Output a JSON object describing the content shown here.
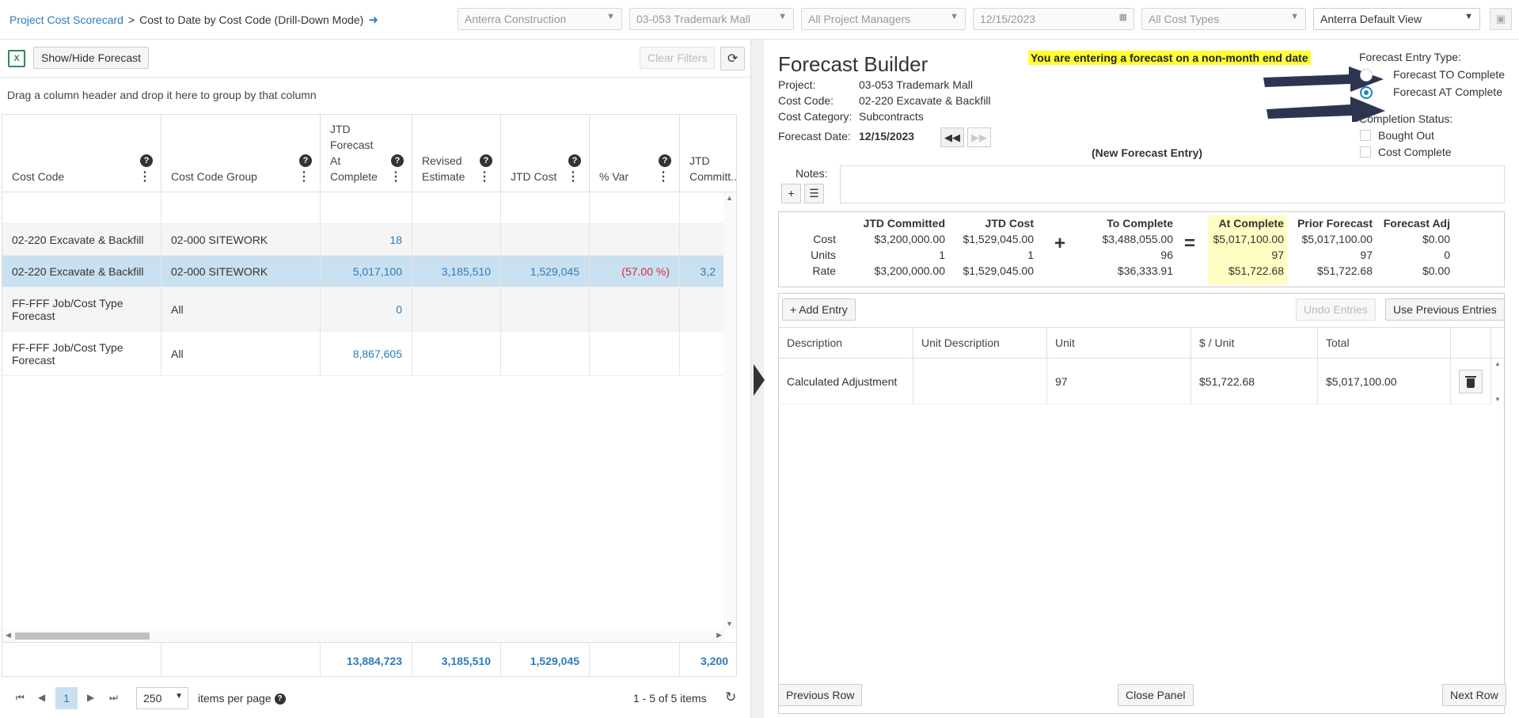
{
  "breadcrumb": {
    "parent": "Project Cost Scorecard",
    "separator": ">",
    "current": "Cost to Date by Cost Code  (Drill-Down Mode)",
    "exit_icon": "exit-arrow-icon"
  },
  "filters": {
    "company": "Anterra Construction",
    "project": "03-053 Trademark Mall",
    "manager": "All Project Managers",
    "date": "12/15/2023",
    "cost_types": "All Cost Types",
    "view": "Anterra Default View"
  },
  "grid_toolbar": {
    "excel_icon": "excel-icon",
    "excel_glyph": "X",
    "show_hide": "Show/Hide Forecast",
    "clear_filters": "Clear Filters",
    "refresh_glyph": "⟳"
  },
  "group_hint": "Drag a column header and drop it here to group by that column",
  "columns": [
    {
      "label": "Cost Code"
    },
    {
      "label": "Cost Code Group"
    },
    {
      "label": "JTD Forecast At Complete"
    },
    {
      "label": "Revised Estimate"
    },
    {
      "label": "JTD Cost"
    },
    {
      "label": "% Var"
    },
    {
      "label": "JTD Committ..."
    }
  ],
  "rows": [
    {
      "code": "",
      "group": "",
      "forecast": "",
      "revised": "",
      "jtd_cost": "",
      "var": "",
      "committed": ""
    },
    {
      "code": "02-220 Excavate & Backfill",
      "group": "02-000 SITEWORK",
      "forecast": "18",
      "revised": "",
      "jtd_cost": "",
      "var": "",
      "committed": ""
    },
    {
      "code": "02-220 Excavate & Backfill",
      "group": "02-000 SITEWORK",
      "forecast": "5,017,100",
      "revised": "3,185,510",
      "jtd_cost": "1,529,045",
      "var": "(57.00 %)",
      "committed": "3,2"
    },
    {
      "code": "FF-FFF Job/Cost Type Forecast",
      "group": "All",
      "forecast": "0",
      "revised": "",
      "jtd_cost": "",
      "var": "",
      "committed": ""
    },
    {
      "code": "FF-FFF Job/Cost Type Forecast",
      "group": "All",
      "forecast": "8,867,605",
      "revised": "",
      "jtd_cost": "",
      "var": "",
      "committed": ""
    }
  ],
  "totals": {
    "forecast": "13,884,723",
    "revised": "3,185,510",
    "jtd_cost": "1,529,045",
    "committed": "3,200"
  },
  "pager": {
    "page": "1",
    "page_size": "250",
    "items_per_page": "items per page",
    "count": "1 - 5 of 5 items"
  },
  "forecast_builder": {
    "title": "Forecast Builder",
    "warning": "You are entering a forecast on a non-month end date",
    "project_label": "Project:",
    "project": "03-053 Trademark Mall",
    "cost_code_label": "Cost Code:",
    "cost_code": "02-220 Excavate & Backfill",
    "cost_category_label": "Cost Category:",
    "cost_category": "Subcontracts",
    "forecast_date_label": "Forecast Date:",
    "forecast_date": "12/15/2023",
    "new_entry": "(New Forecast Entry)",
    "entry_type_label": "Forecast Entry Type:",
    "option_to": "Forecast TO Complete",
    "option_at": "Forecast AT Complete",
    "option_at_selected": true,
    "completion_label": "Completion Status:",
    "bought_out": "Bought Out",
    "cost_complete": "Cost Complete",
    "notes_label": "Notes:"
  },
  "summary": {
    "headers": [
      "JTD Committed",
      "JTD Cost",
      "To Complete",
      "At Complete",
      "Prior Forecast",
      "Forecast Adj"
    ],
    "row_labels": [
      "Cost",
      "Units",
      "Rate"
    ],
    "plus": "+",
    "equals": "=",
    "values": [
      [
        "$3,200,000.00",
        "$1,529,045.00",
        "$3,488,055.00",
        "$5,017,100.00",
        "$5,017,100.00",
        "$0.00"
      ],
      [
        "1",
        "1",
        "96",
        "97",
        "97",
        "0"
      ],
      [
        "$3,200,000.00",
        "$1,529,045.00",
        "$36,333.91",
        "$51,722.68",
        "$51,722.68",
        "$0.00"
      ]
    ]
  },
  "entries": {
    "add": "Add Entry",
    "undo": "Undo Entries",
    "use_previous": "Use Previous Entries",
    "columns": [
      "Description",
      "Unit Description",
      "Unit",
      "$ / Unit",
      "Total"
    ],
    "rows": [
      {
        "description": "Calculated Adjustment",
        "unit_description": "",
        "unit": "97",
        "per_unit": "$51,722.68",
        "total": "$5,017,100.00"
      }
    ]
  },
  "footer_buttons": {
    "previous": "Previous Row",
    "close": "Close Panel",
    "next": "Next Row"
  },
  "colors": {
    "link": "#2b7bbf",
    "selected_row": "#c9e0f0",
    "warning_bg": "#ffff33",
    "highlight": "#ffffc4",
    "negative": "#d9283a",
    "arrow": "#2b3550"
  }
}
